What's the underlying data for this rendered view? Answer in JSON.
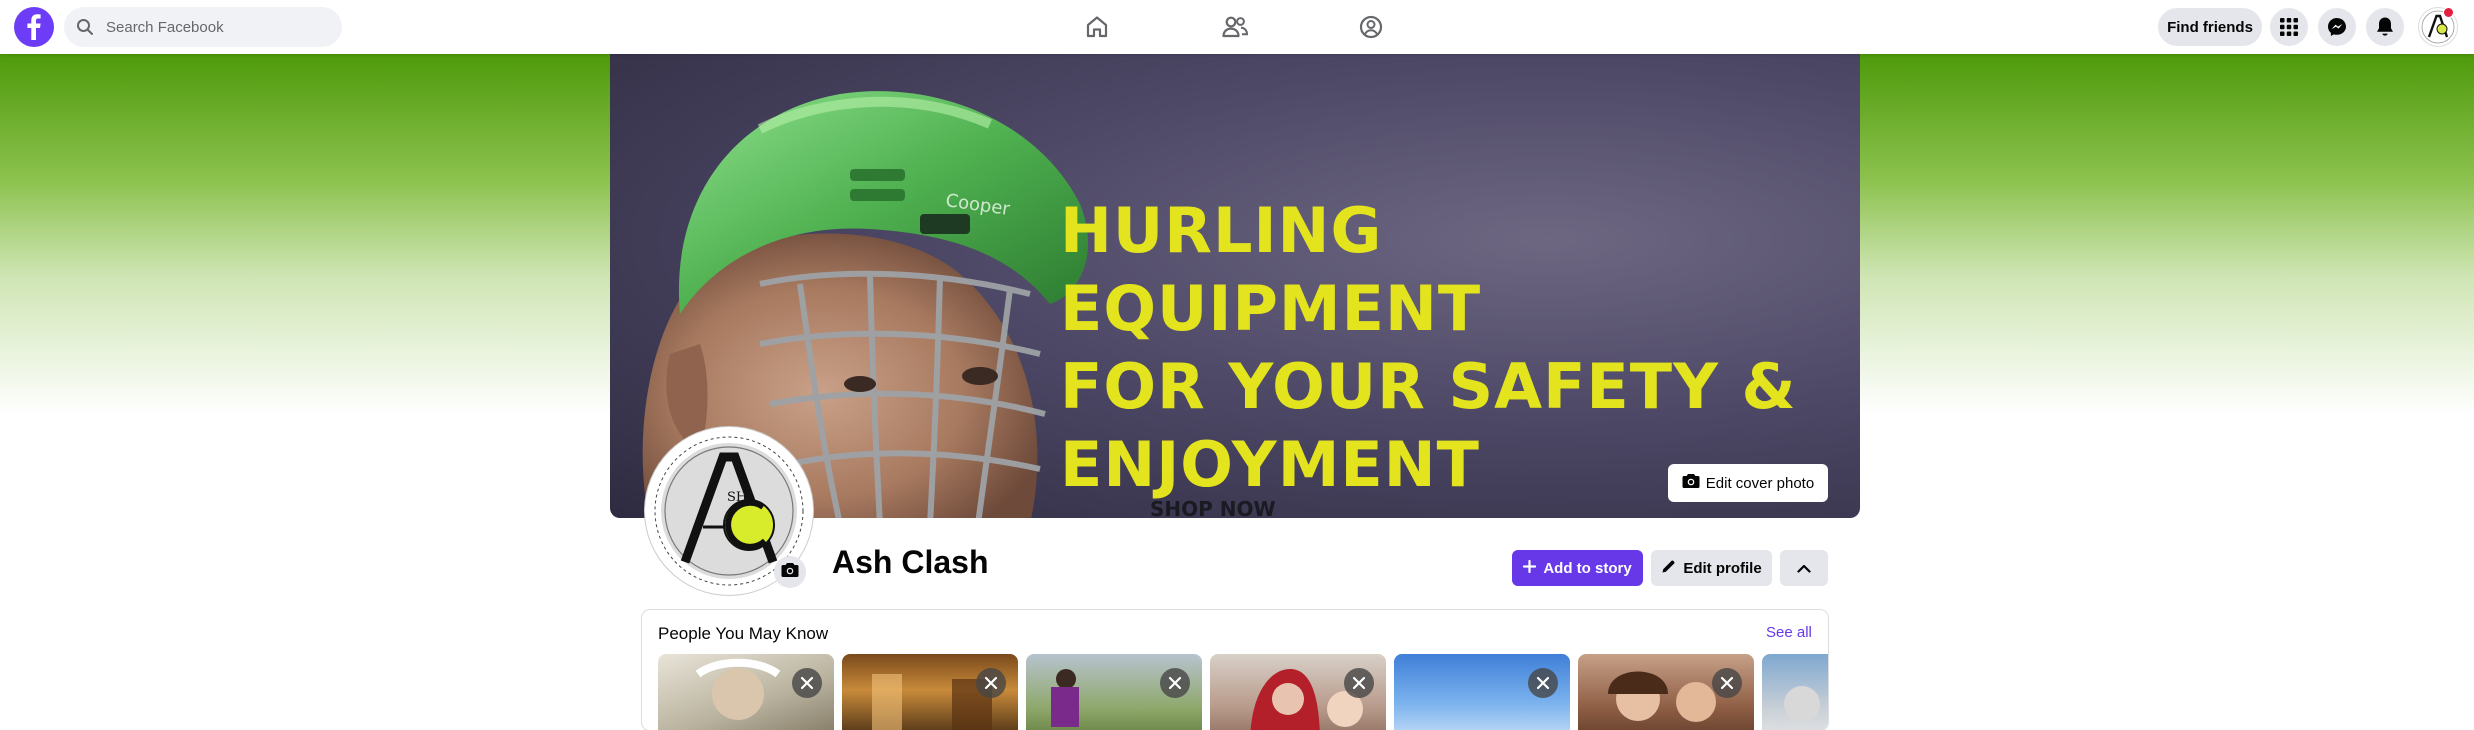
{
  "topbar": {
    "search_placeholder": "Search Facebook",
    "find_friends_label": "Find friends",
    "nav_icons": [
      "home-icon",
      "friends-icon",
      "groups-icon"
    ],
    "action_icons": [
      "menu-grid-icon",
      "messenger-icon",
      "notifications-bell-icon"
    ]
  },
  "cover": {
    "headline_lines": [
      "HURLING EQUIPMENT",
      "FOR YOUR SAFETY &",
      "ENJOYMENT"
    ],
    "shop_text": "SHOP NOW",
    "edit_label": "Edit cover photo",
    "headline_color": "#e3e31e"
  },
  "profile": {
    "name": "Ash Clash",
    "logo_text": "SH",
    "add_story_label": "Add to story",
    "edit_profile_label": "Edit profile"
  },
  "pymk": {
    "title": "People You May Know",
    "see_all": "See all",
    "card_count": 7
  },
  "colors": {
    "accent": "#6638e8",
    "logo": "#6d3cf7",
    "gradient_top": "#4e9a0b",
    "badge_red": "#e41e3f"
  }
}
